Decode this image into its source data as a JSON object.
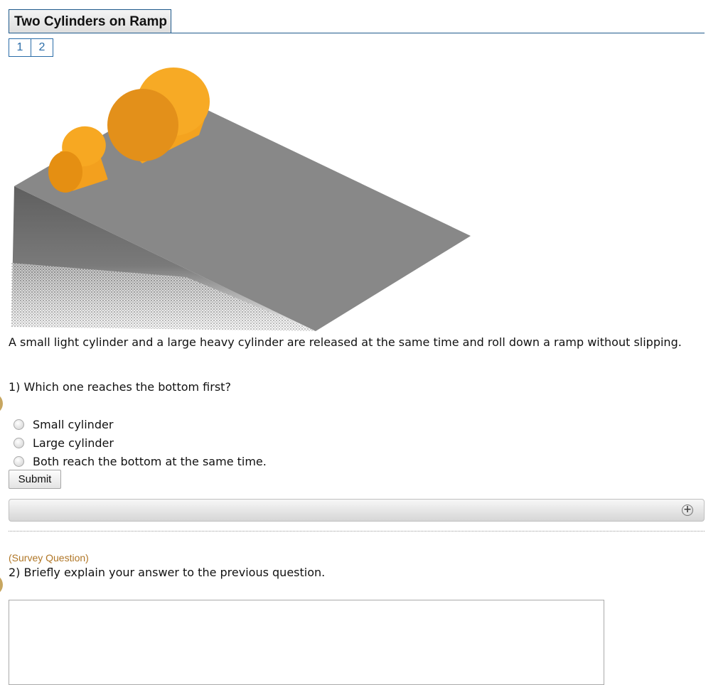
{
  "header": {
    "title": "Two Cylinders on Ramp",
    "pages": [
      "1",
      "2"
    ]
  },
  "figure": {
    "cylinder_color": "#f5a020",
    "ramp_color": "#888888"
  },
  "intro_text": "A small light cylinder and a large heavy cylinder are released at the same time and roll down a ramp without slipping.",
  "question1": {
    "prompt": "1) Which one reaches the bottom first?",
    "options": [
      "Small cylinder",
      "Large cylinder",
      "Both reach the bottom at the same time."
    ],
    "submit_label": "Submit"
  },
  "question2": {
    "tag": "(Survey Question)",
    "prompt": "2) Briefly explain your answer to the previous question.",
    "answer_value": ""
  },
  "colors": {
    "accent": "#1f5a8c",
    "survey_tag": "#b07626"
  }
}
